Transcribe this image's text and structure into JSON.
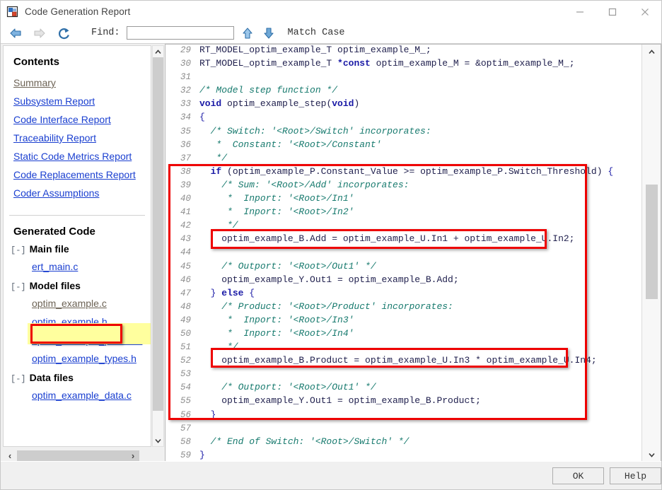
{
  "window": {
    "title": "Code Generation Report",
    "app_icon": "report-icon",
    "minimize": "minimize-icon",
    "maximize": "maximize-icon",
    "close": "close-icon"
  },
  "toolbar": {
    "back_icon": "back-arrow-icon",
    "forward_icon": "forward-arrow-icon",
    "refresh_icon": "refresh-icon",
    "find_label": "Find:",
    "find_value": "",
    "find_placeholder": "",
    "find_prev_icon": "find-previous-icon",
    "find_next_icon": "find-next-icon",
    "match_case_label": "Match Case"
  },
  "sidebar": {
    "contents_title": "Contents",
    "contents_links": [
      {
        "label": "Summary",
        "visited": true
      },
      {
        "label": "Subsystem Report",
        "visited": false
      },
      {
        "label": "Code Interface Report",
        "visited": false
      },
      {
        "label": "Traceability Report",
        "visited": false
      },
      {
        "label": "Static Code Metrics Report",
        "visited": false
      },
      {
        "label": "Code Replacements Report",
        "visited": false
      },
      {
        "label": "Coder Assumptions",
        "visited": false
      }
    ],
    "generated_code_title": "Generated Code",
    "groups": [
      {
        "toggle": "[-]",
        "label": "Main file",
        "files": [
          {
            "label": "ert_main.c",
            "visited": false,
            "selected": false
          }
        ]
      },
      {
        "toggle": "[-]",
        "label": "Model files",
        "files": [
          {
            "label": "optim_example.c",
            "visited": true,
            "selected": true
          },
          {
            "label": "optim_example.h",
            "visited": false,
            "selected": false
          },
          {
            "label": "optim_example_private.h",
            "visited": false,
            "selected": false
          },
          {
            "label": "optim_example_types.h",
            "visited": false,
            "selected": false
          }
        ]
      },
      {
        "toggle": "[-]",
        "label": "Data files",
        "files": [
          {
            "label": "optim_example_data.c",
            "visited": false,
            "selected": false
          }
        ]
      }
    ],
    "scroll_up_icon": "chevron-up-icon",
    "scroll_down_icon": "chevron-down-icon",
    "scroll_left_icon": "chevron-left-icon",
    "scroll_right_icon": "chevron-right-icon"
  },
  "code_view": {
    "scroll_up_icon": "chevron-up-icon",
    "scroll_down_icon": "chevron-down-icon",
    "first_visible_line": 29,
    "last_visible_line": 59,
    "lines": [
      {
        "n": "29",
        "tokens": [
          {
            "t": "pl",
            "s": "RT_MODEL_optim_example_T optim_example_M_;"
          }
        ],
        "indent": 0
      },
      {
        "n": "30",
        "tokens": [
          {
            "t": "pl",
            "s": "RT_MODEL_optim_example_T "
          },
          {
            "t": "kw",
            "s": "*const"
          },
          {
            "t": "pl",
            "s": " optim_example_M = &optim_example_M_;"
          }
        ],
        "indent": 0
      },
      {
        "n": "31",
        "tokens": [
          {
            "t": "pl",
            "s": ""
          }
        ],
        "indent": 0
      },
      {
        "n": "32",
        "tokens": [
          {
            "t": "cm",
            "s": "/* Model step function */"
          }
        ],
        "indent": 0
      },
      {
        "n": "33",
        "tokens": [
          {
            "t": "kw",
            "s": "void"
          },
          {
            "t": "pl",
            "s": " optim_example_step("
          },
          {
            "t": "kw",
            "s": "void"
          },
          {
            "t": "pl",
            "s": ")"
          }
        ],
        "indent": 0
      },
      {
        "n": "34",
        "tokens": [
          {
            "t": "pn",
            "s": "{"
          }
        ],
        "indent": 0
      },
      {
        "n": "35",
        "tokens": [
          {
            "t": "cm",
            "s": "/* Switch: '<Root>/Switch' incorporates:"
          }
        ],
        "indent": 1
      },
      {
        "n": "36",
        "tokens": [
          {
            "t": "cm",
            "s": " *  Constant: '<Root>/Constant'"
          }
        ],
        "indent": 1
      },
      {
        "n": "37",
        "tokens": [
          {
            "t": "cm",
            "s": " */"
          }
        ],
        "indent": 1
      },
      {
        "n": "38",
        "tokens": [
          {
            "t": "kw",
            "s": "if"
          },
          {
            "t": "pl",
            "s": " (optim_example_P.Constant_Value >= optim_example_P.Switch_Threshold) "
          },
          {
            "t": "pn",
            "s": "{"
          }
        ],
        "indent": 1
      },
      {
        "n": "39",
        "tokens": [
          {
            "t": "cm",
            "s": "/* Sum: '<Root>/Add' incorporates:"
          }
        ],
        "indent": 2
      },
      {
        "n": "40",
        "tokens": [
          {
            "t": "cm",
            "s": " *  Inport: '<Root>/In1'"
          }
        ],
        "indent": 2
      },
      {
        "n": "41",
        "tokens": [
          {
            "t": "cm",
            "s": " *  Inport: '<Root>/In2'"
          }
        ],
        "indent": 2
      },
      {
        "n": "42",
        "tokens": [
          {
            "t": "cm",
            "s": " */"
          }
        ],
        "indent": 2
      },
      {
        "n": "43",
        "tokens": [
          {
            "t": "pl",
            "s": "optim_example_B.Add = optim_example_U.In1 + optim_example_U.In2;"
          }
        ],
        "indent": 2
      },
      {
        "n": "44",
        "tokens": [
          {
            "t": "pl",
            "s": ""
          }
        ],
        "indent": 0
      },
      {
        "n": "45",
        "tokens": [
          {
            "t": "cm",
            "s": "/* Outport: '<Root>/Out1' */"
          }
        ],
        "indent": 2
      },
      {
        "n": "46",
        "tokens": [
          {
            "t": "pl",
            "s": "optim_example_Y.Out1 = optim_example_B.Add;"
          }
        ],
        "indent": 2
      },
      {
        "n": "47",
        "tokens": [
          {
            "t": "pn",
            "s": "} "
          },
          {
            "t": "kw",
            "s": "else"
          },
          {
            "t": "pn",
            "s": " {"
          }
        ],
        "indent": 1
      },
      {
        "n": "48",
        "tokens": [
          {
            "t": "cm",
            "s": "/* Product: '<Root>/Product' incorporates:"
          }
        ],
        "indent": 2
      },
      {
        "n": "49",
        "tokens": [
          {
            "t": "cm",
            "s": " *  Inport: '<Root>/In3'"
          }
        ],
        "indent": 2
      },
      {
        "n": "50",
        "tokens": [
          {
            "t": "cm",
            "s": " *  Inport: '<Root>/In4'"
          }
        ],
        "indent": 2
      },
      {
        "n": "51",
        "tokens": [
          {
            "t": "cm",
            "s": " */"
          }
        ],
        "indent": 2
      },
      {
        "n": "52",
        "tokens": [
          {
            "t": "pl",
            "s": "optim_example_B.Product = optim_example_U.In3 * optim_example_U.In4;"
          }
        ],
        "indent": 2
      },
      {
        "n": "53",
        "tokens": [
          {
            "t": "pl",
            "s": ""
          }
        ],
        "indent": 0
      },
      {
        "n": "54",
        "tokens": [
          {
            "t": "cm",
            "s": "/* Outport: '<Root>/Out1' */"
          }
        ],
        "indent": 2
      },
      {
        "n": "55",
        "tokens": [
          {
            "t": "pl",
            "s": "optim_example_Y.Out1 = optim_example_B.Product;"
          }
        ],
        "indent": 2
      },
      {
        "n": "56",
        "tokens": [
          {
            "t": "pn",
            "s": "}"
          }
        ],
        "indent": 1
      },
      {
        "n": "57",
        "tokens": [
          {
            "t": "pl",
            "s": ""
          }
        ],
        "indent": 0
      },
      {
        "n": "58",
        "tokens": [
          {
            "t": "cm",
            "s": "/* End of Switch: '<Root>/Switch' */"
          }
        ],
        "indent": 1
      },
      {
        "n": "59",
        "tokens": [
          {
            "t": "pn",
            "s": "}"
          }
        ],
        "indent": 0
      }
    ]
  },
  "annotations": {
    "outer_box_lines": "38-56",
    "add_box_line": "43",
    "product_box_line": "52",
    "sidebar_box_file": "optim_example.c",
    "box_color": "#ee0000",
    "highlight_color": "#ffff9e"
  },
  "footer": {
    "ok_label": "OK",
    "help_label": "Help"
  },
  "theme": {
    "link_color": "#1a3fd0",
    "visited_link_color": "#6d6355",
    "comment_color": "#177a6e",
    "keyword_color": "#1a1aa6",
    "code_color": "#1f1f4d",
    "chrome_bg": "#f0f0f0"
  }
}
